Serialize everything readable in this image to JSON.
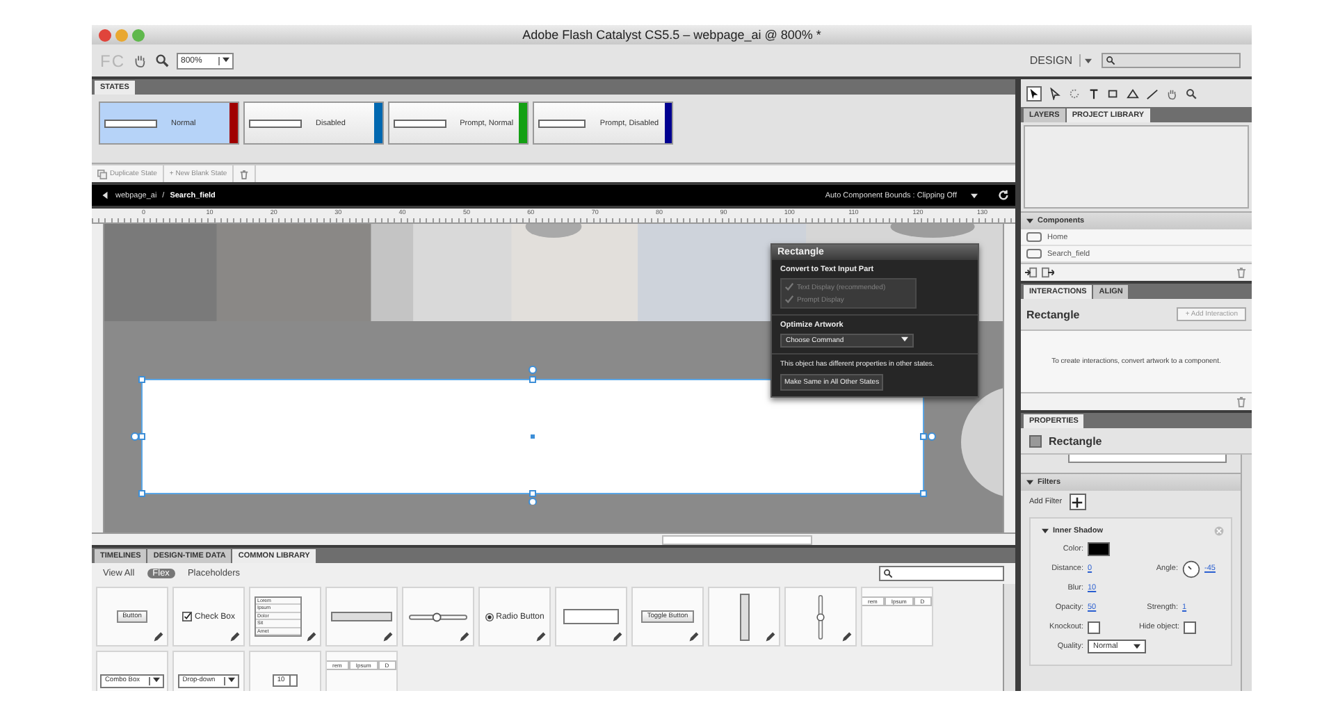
{
  "window": {
    "title": "Adobe Flash Catalyst CS5.5 – webpage_ai @ 800% *"
  },
  "toolbar": {
    "logo": "FC",
    "zoom": "800%",
    "workspace": "DESIGN"
  },
  "states_panel": {
    "tab": "STATES",
    "states": [
      {
        "label": "Normal",
        "selected": true,
        "color": "#a00000"
      },
      {
        "label": "Disabled",
        "selected": false,
        "color": "#0068b0"
      },
      {
        "label": "Prompt, Normal",
        "selected": false,
        "color": "#14a014"
      },
      {
        "label": "Prompt, Disabled",
        "selected": false,
        "color": "#000090"
      }
    ],
    "duplicate": "Duplicate State",
    "new_blank": "+ New Blank State"
  },
  "breadcrumb": {
    "parent": "webpage_ai",
    "separator": "/",
    "current": "Search_field",
    "bounds": "Auto Component Bounds : Clipping Off"
  },
  "ruler": {
    "ticks": [
      "0",
      "10",
      "20",
      "30",
      "40",
      "50",
      "60",
      "70",
      "80",
      "90",
      "100",
      "110",
      "120",
      "130"
    ]
  },
  "hud": {
    "title": "Rectangle",
    "convert_heading": "Convert to Text Input Part",
    "options": [
      {
        "label": "Text Display (recommended)",
        "checked": true
      },
      {
        "label": "Prompt Display",
        "checked": true
      }
    ],
    "optimize_heading": "Optimize Artwork",
    "command": "Choose Command",
    "message": "This object has different properties in other states.",
    "button": "Make Same in All Other States"
  },
  "library": {
    "tabs": [
      {
        "label": "TIMELINES",
        "selected": false
      },
      {
        "label": "DESIGN-TIME DATA",
        "selected": false
      },
      {
        "label": "COMMON LIBRARY",
        "selected": true
      }
    ],
    "filters": [
      {
        "label": "View All",
        "selected": false
      },
      {
        "label": "Flex",
        "selected": true
      },
      {
        "label": "Placeholders",
        "selected": false
      }
    ],
    "items": [
      {
        "kind": "button",
        "label": "Button",
        "edit_icon": true
      },
      {
        "kind": "checkbox",
        "label": "Check Box",
        "edit_icon": true
      },
      {
        "kind": "list",
        "lines": [
          "Lorem",
          "Ipsum",
          "Dolor",
          "Sit",
          "Amet"
        ],
        "edit_icon": true
      },
      {
        "kind": "hscrollbar",
        "edit_icon": true
      },
      {
        "kind": "hslider",
        "edit_icon": true
      },
      {
        "kind": "radio",
        "label": "Radio Button",
        "edit_icon": true
      },
      {
        "kind": "textinput",
        "edit_icon": true
      },
      {
        "kind": "toggle",
        "label": "Toggle Button",
        "edit_icon": true
      },
      {
        "kind": "vscrollbar",
        "edit_icon": true
      },
      {
        "kind": "vslider",
        "edit_icon": true
      },
      {
        "kind": "tabbar",
        "labels": [
          "rem",
          "Ipsum",
          "D"
        ],
        "edit_icon": false
      },
      {
        "kind": "combo",
        "label": "Combo Box",
        "edit_icon": false
      },
      {
        "kind": "dropdown",
        "label": "Drop-down",
        "edit_icon": false
      },
      {
        "kind": "stepper",
        "label": "10",
        "edit_icon": false
      },
      {
        "kind": "tabbar",
        "labels": [
          "rem",
          "Ipsum",
          "D"
        ],
        "edit_icon": false
      }
    ]
  },
  "project_panel": {
    "tabs": [
      {
        "label": "LAYERS",
        "selected": false
      },
      {
        "label": "PROJECT LIBRARY",
        "selected": true
      }
    ],
    "section": "Components",
    "items": [
      "Home",
      "Search_field"
    ]
  },
  "interactions_panel": {
    "tabs": [
      {
        "label": "INTERACTIONS",
        "selected": true
      },
      {
        "label": "ALIGN",
        "selected": false
      }
    ],
    "object": "Rectangle",
    "add_button": "+ Add Interaction",
    "message": "To create interactions, convert artwork to a component."
  },
  "properties_panel": {
    "tab": "PROPERTIES",
    "object": "Rectangle",
    "section": "Filters",
    "add_filter": "Add Filter",
    "filter": {
      "name": "Inner Shadow",
      "color_label": "Color:",
      "color": "#000000",
      "distance_label": "Distance:",
      "distance": "0",
      "angle_label": "Angle:",
      "angle": "-45",
      "blur_label": "Blur:",
      "blur": "10",
      "opacity_label": "Opacity:",
      "opacity": "50",
      "strength_label": "Strength:",
      "strength": "1",
      "knockout_label": "Knockout:",
      "knockout": false,
      "hide_label": "Hide object:",
      "hide_object": false,
      "quality_label": "Quality:",
      "quality": "Normal"
    }
  }
}
